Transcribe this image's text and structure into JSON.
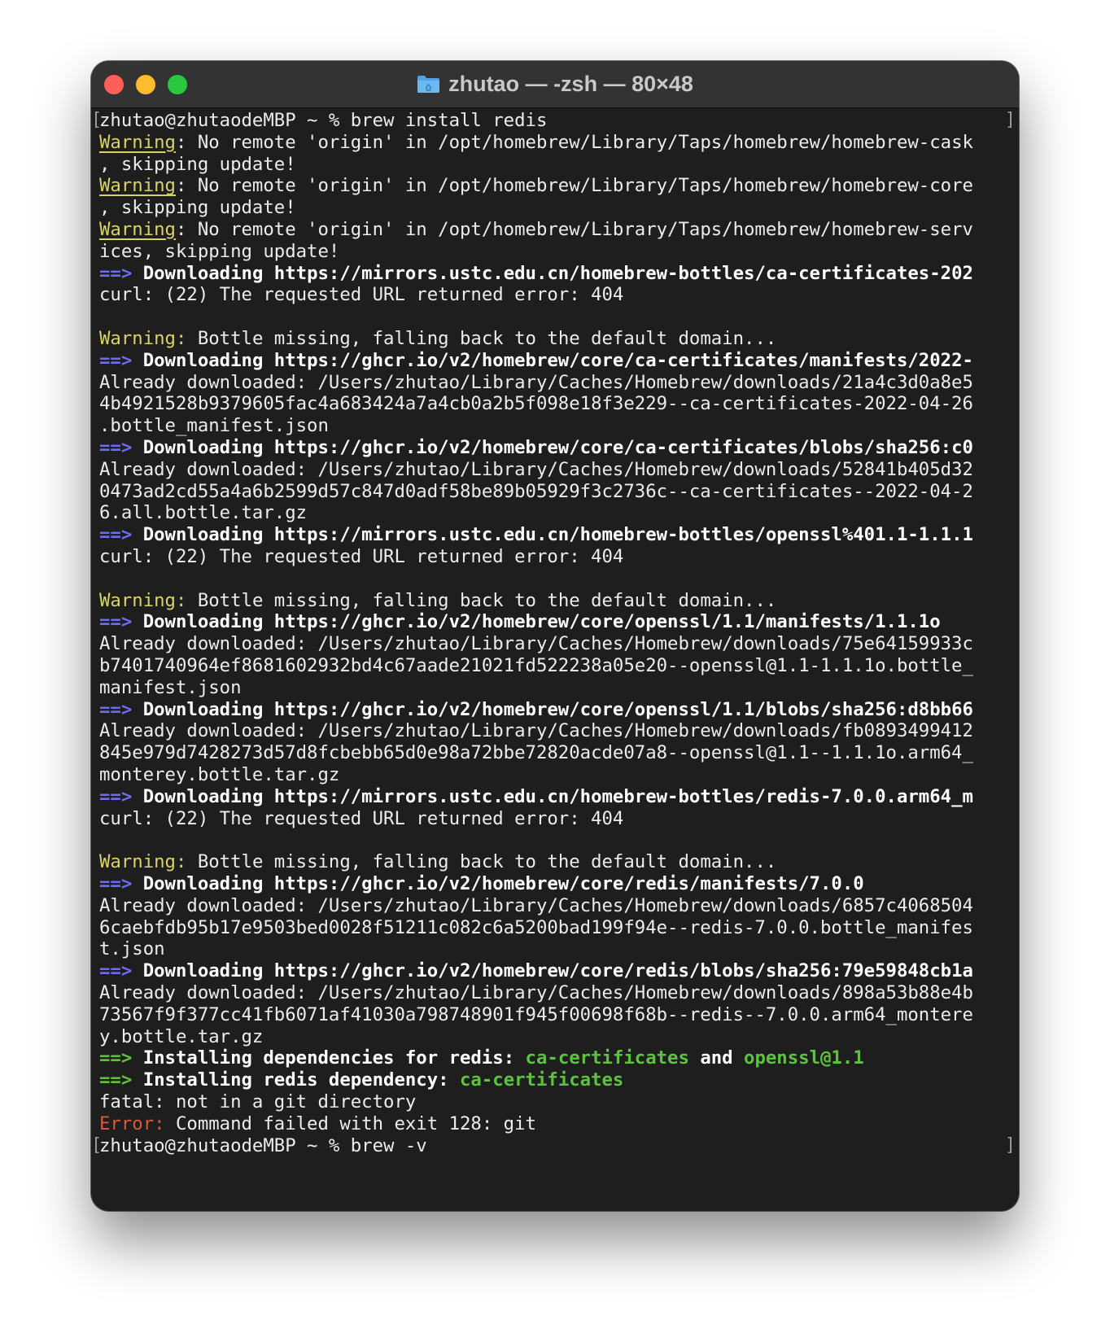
{
  "window": {
    "title": "zhutao — -zsh — 80×48"
  },
  "terminal": {
    "lines": [
      {
        "segs": [
          {
            "t": "zhutao@zhutaodeMBP ~ % brew install redis"
          }
        ],
        "brackets": true
      },
      {
        "segs": [
          {
            "t": "Warning",
            "c": "warn-u"
          },
          {
            "t": ": No remote 'origin' in /opt/homebrew/Library/Taps/homebrew/homebrew-cask"
          }
        ]
      },
      {
        "segs": [
          {
            "t": ", skipping update!"
          }
        ]
      },
      {
        "segs": [
          {
            "t": "Warning",
            "c": "warn-u"
          },
          {
            "t": ": No remote 'origin' in /opt/homebrew/Library/Taps/homebrew/homebrew-core"
          }
        ]
      },
      {
        "segs": [
          {
            "t": ", skipping update!"
          }
        ]
      },
      {
        "segs": [
          {
            "t": "Warning",
            "c": "warn-u"
          },
          {
            "t": ": No remote 'origin' in /opt/homebrew/Library/Taps/homebrew/homebrew-serv"
          }
        ]
      },
      {
        "segs": [
          {
            "t": "ices, skipping update!"
          }
        ]
      },
      {
        "segs": [
          {
            "t": "==>",
            "c": "arrow"
          },
          {
            "t": " Downloading https://mirrors.ustc.edu.cn/homebrew-bottles/ca-certificates-202",
            "c": "bold"
          }
        ]
      },
      {
        "segs": [
          {
            "t": "curl: (22) The requested URL returned error: 404"
          }
        ]
      },
      {
        "segs": [
          {
            "t": ""
          }
        ]
      },
      {
        "segs": [
          {
            "t": "Warning:",
            "c": "warn"
          },
          {
            "t": " Bottle missing, falling back to the default domain..."
          }
        ]
      },
      {
        "segs": [
          {
            "t": "==>",
            "c": "arrow"
          },
          {
            "t": " Downloading https://ghcr.io/v2/homebrew/core/ca-certificates/manifests/2022-",
            "c": "bold"
          }
        ]
      },
      {
        "segs": [
          {
            "t": "Already downloaded: /Users/zhutao/Library/Caches/Homebrew/downloads/21a4c3d0a8e5"
          }
        ]
      },
      {
        "segs": [
          {
            "t": "4b4921528b9379605fac4a683424a7a4cb0a2b5f098e18f3e229--ca-certificates-2022-04-26"
          }
        ]
      },
      {
        "segs": [
          {
            "t": ".bottle_manifest.json"
          }
        ]
      },
      {
        "segs": [
          {
            "t": "==>",
            "c": "arrow"
          },
          {
            "t": " Downloading https://ghcr.io/v2/homebrew/core/ca-certificates/blobs/sha256:c0",
            "c": "bold"
          }
        ]
      },
      {
        "segs": [
          {
            "t": "Already downloaded: /Users/zhutao/Library/Caches/Homebrew/downloads/52841b405d32"
          }
        ]
      },
      {
        "segs": [
          {
            "t": "0473ad2cd55a4a6b2599d57c847d0adf58be89b05929f3c2736c--ca-certificates--2022-04-2"
          }
        ]
      },
      {
        "segs": [
          {
            "t": "6.all.bottle.tar.gz"
          }
        ]
      },
      {
        "segs": [
          {
            "t": "==>",
            "c": "arrow"
          },
          {
            "t": " Downloading https://mirrors.ustc.edu.cn/homebrew-bottles/openssl%401.1-1.1.1",
            "c": "bold"
          }
        ]
      },
      {
        "segs": [
          {
            "t": "curl: (22) The requested URL returned error: 404"
          }
        ]
      },
      {
        "segs": [
          {
            "t": ""
          }
        ]
      },
      {
        "segs": [
          {
            "t": "Warning:",
            "c": "warn"
          },
          {
            "t": " Bottle missing, falling back to the default domain..."
          }
        ]
      },
      {
        "segs": [
          {
            "t": "==>",
            "c": "arrow"
          },
          {
            "t": " Downloading https://ghcr.io/v2/homebrew/core/openssl/1.1/manifests/1.1.1o",
            "c": "bold"
          }
        ]
      },
      {
        "segs": [
          {
            "t": "Already downloaded: /Users/zhutao/Library/Caches/Homebrew/downloads/75e64159933c"
          }
        ]
      },
      {
        "segs": [
          {
            "t": "b7401740964ef8681602932bd4c67aade21021fd522238a05e20--openssl@1.1-1.1.1o.bottle_"
          }
        ]
      },
      {
        "segs": [
          {
            "t": "manifest.json"
          }
        ]
      },
      {
        "segs": [
          {
            "t": "==>",
            "c": "arrow"
          },
          {
            "t": " Downloading https://ghcr.io/v2/homebrew/core/openssl/1.1/blobs/sha256:d8bb66",
            "c": "bold"
          }
        ]
      },
      {
        "segs": [
          {
            "t": "Already downloaded: /Users/zhutao/Library/Caches/Homebrew/downloads/fb0893499412"
          }
        ]
      },
      {
        "segs": [
          {
            "t": "845e979d7428273d57d8fcbebb65d0e98a72bbe72820acde07a8--openssl@1.1--1.1.1o.arm64_"
          }
        ]
      },
      {
        "segs": [
          {
            "t": "monterey.bottle.tar.gz"
          }
        ]
      },
      {
        "segs": [
          {
            "t": "==>",
            "c": "arrow"
          },
          {
            "t": " Downloading https://mirrors.ustc.edu.cn/homebrew-bottles/redis-7.0.0.arm64_m",
            "c": "bold"
          }
        ]
      },
      {
        "segs": [
          {
            "t": "curl: (22) The requested URL returned error: 404"
          }
        ]
      },
      {
        "segs": [
          {
            "t": ""
          }
        ]
      },
      {
        "segs": [
          {
            "t": "Warning:",
            "c": "warn"
          },
          {
            "t": " Bottle missing, falling back to the default domain..."
          }
        ]
      },
      {
        "segs": [
          {
            "t": "==>",
            "c": "arrow"
          },
          {
            "t": " Downloading https://ghcr.io/v2/homebrew/core/redis/manifests/7.0.0",
            "c": "bold"
          }
        ]
      },
      {
        "segs": [
          {
            "t": "Already downloaded: /Users/zhutao/Library/Caches/Homebrew/downloads/6857c4068504"
          }
        ]
      },
      {
        "segs": [
          {
            "t": "6caebfdb95b17e9503bed0028f51211c082c6a5200bad199f94e--redis-7.0.0.bottle_manifes"
          }
        ]
      },
      {
        "segs": [
          {
            "t": "t.json"
          }
        ]
      },
      {
        "segs": [
          {
            "t": "==>",
            "c": "arrow"
          },
          {
            "t": " Downloading https://ghcr.io/v2/homebrew/core/redis/blobs/sha256:79e59848cb1a",
            "c": "bold"
          }
        ]
      },
      {
        "segs": [
          {
            "t": "Already downloaded: /Users/zhutao/Library/Caches/Homebrew/downloads/898a53b88e4b"
          }
        ]
      },
      {
        "segs": [
          {
            "t": "73567f9f377cc41fb6071af41030a798748901f945f00698f68b--redis--7.0.0.arm64_montere"
          }
        ]
      },
      {
        "segs": [
          {
            "t": "y.bottle.tar.gz"
          }
        ]
      },
      {
        "segs": [
          {
            "t": "==>",
            "c": "green"
          },
          {
            "t": " Installing dependencies for redis: ",
            "c": "bold"
          },
          {
            "t": "ca-certificates",
            "c": "green"
          },
          {
            "t": " and ",
            "c": "bold"
          },
          {
            "t": "openssl@1.1",
            "c": "green"
          }
        ]
      },
      {
        "segs": [
          {
            "t": "==>",
            "c": "green"
          },
          {
            "t": " Installing redis dependency: ",
            "c": "bold"
          },
          {
            "t": "ca-certificates",
            "c": "green"
          }
        ]
      },
      {
        "segs": [
          {
            "t": "fatal: not in a git directory"
          }
        ]
      },
      {
        "segs": [
          {
            "t": "Error:",
            "c": "err"
          },
          {
            "t": " Command failed with exit 128: git"
          }
        ]
      },
      {
        "segs": [
          {
            "t": "zhutao@zhutaodeMBP ~ % brew -v"
          }
        ],
        "brackets": true
      }
    ]
  },
  "icons": {
    "folder": "folder-icon",
    "traffic_lights": [
      "close-button",
      "minimize-button",
      "zoom-button"
    ]
  },
  "colors": {
    "background": "#1e1e1e",
    "warning": "#d8d367",
    "arrow": "#6b6cf2",
    "success": "#5dc33f",
    "error": "#d9593b"
  }
}
